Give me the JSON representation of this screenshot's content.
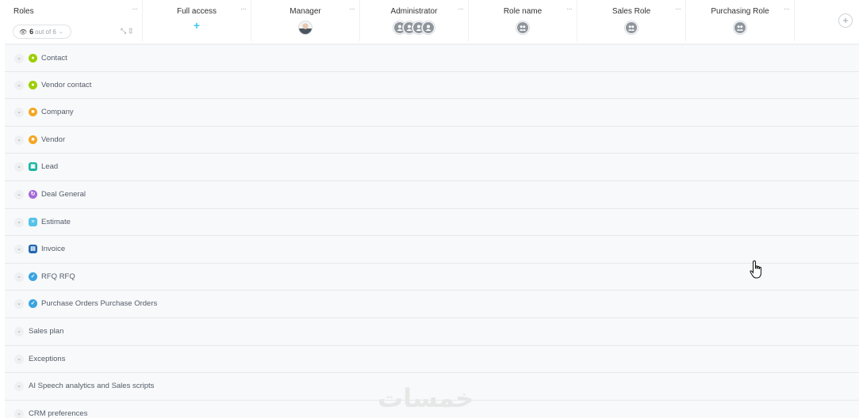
{
  "header": {
    "roles_title": "Roles",
    "counter": {
      "current": "6",
      "suffix": "out of 6"
    },
    "columns": [
      {
        "title": "Full access",
        "members": "add"
      },
      {
        "title": "Manager",
        "members": "photo"
      },
      {
        "title": "Administrator",
        "members": "group-stack"
      },
      {
        "title": "Role name",
        "members": "group"
      },
      {
        "title": "Sales Role",
        "members": "group"
      },
      {
        "title": "Purchasing Role",
        "members": "group"
      }
    ]
  },
  "rows": [
    {
      "label": "Contact",
      "icon": "contact-icon",
      "color": "#9dcf00"
    },
    {
      "label": "Vendor contact",
      "icon": "contact-icon",
      "color": "#9dcf00"
    },
    {
      "label": "Company",
      "icon": "company-icon",
      "color": "#f5a623"
    },
    {
      "label": "Vendor",
      "icon": "company-icon",
      "color": "#f5a623"
    },
    {
      "label": "Lead",
      "icon": "lead-icon",
      "color": "#19b5a3"
    },
    {
      "label": "Deal General",
      "icon": "deal-icon",
      "color": "#a569d8"
    },
    {
      "label": "Estimate",
      "icon": "estimate-icon",
      "color": "#55c3e8"
    },
    {
      "label": "Invoice",
      "icon": "invoice-icon",
      "color": "#2066b0"
    },
    {
      "label": "RFQ RFQ",
      "icon": "check-circle-icon",
      "color": "#3aa3e0"
    },
    {
      "label": "Purchase Orders Purchase Orders",
      "icon": "check-circle-icon",
      "color": "#3aa3e0"
    },
    {
      "label": "Sales plan",
      "icon": null
    },
    {
      "label": "Exceptions",
      "icon": null
    },
    {
      "label": "AI Speech analytics and Sales scripts",
      "icon": null
    },
    {
      "label": "CRM preferences",
      "icon": null
    }
  ],
  "watermark": "خمسات"
}
